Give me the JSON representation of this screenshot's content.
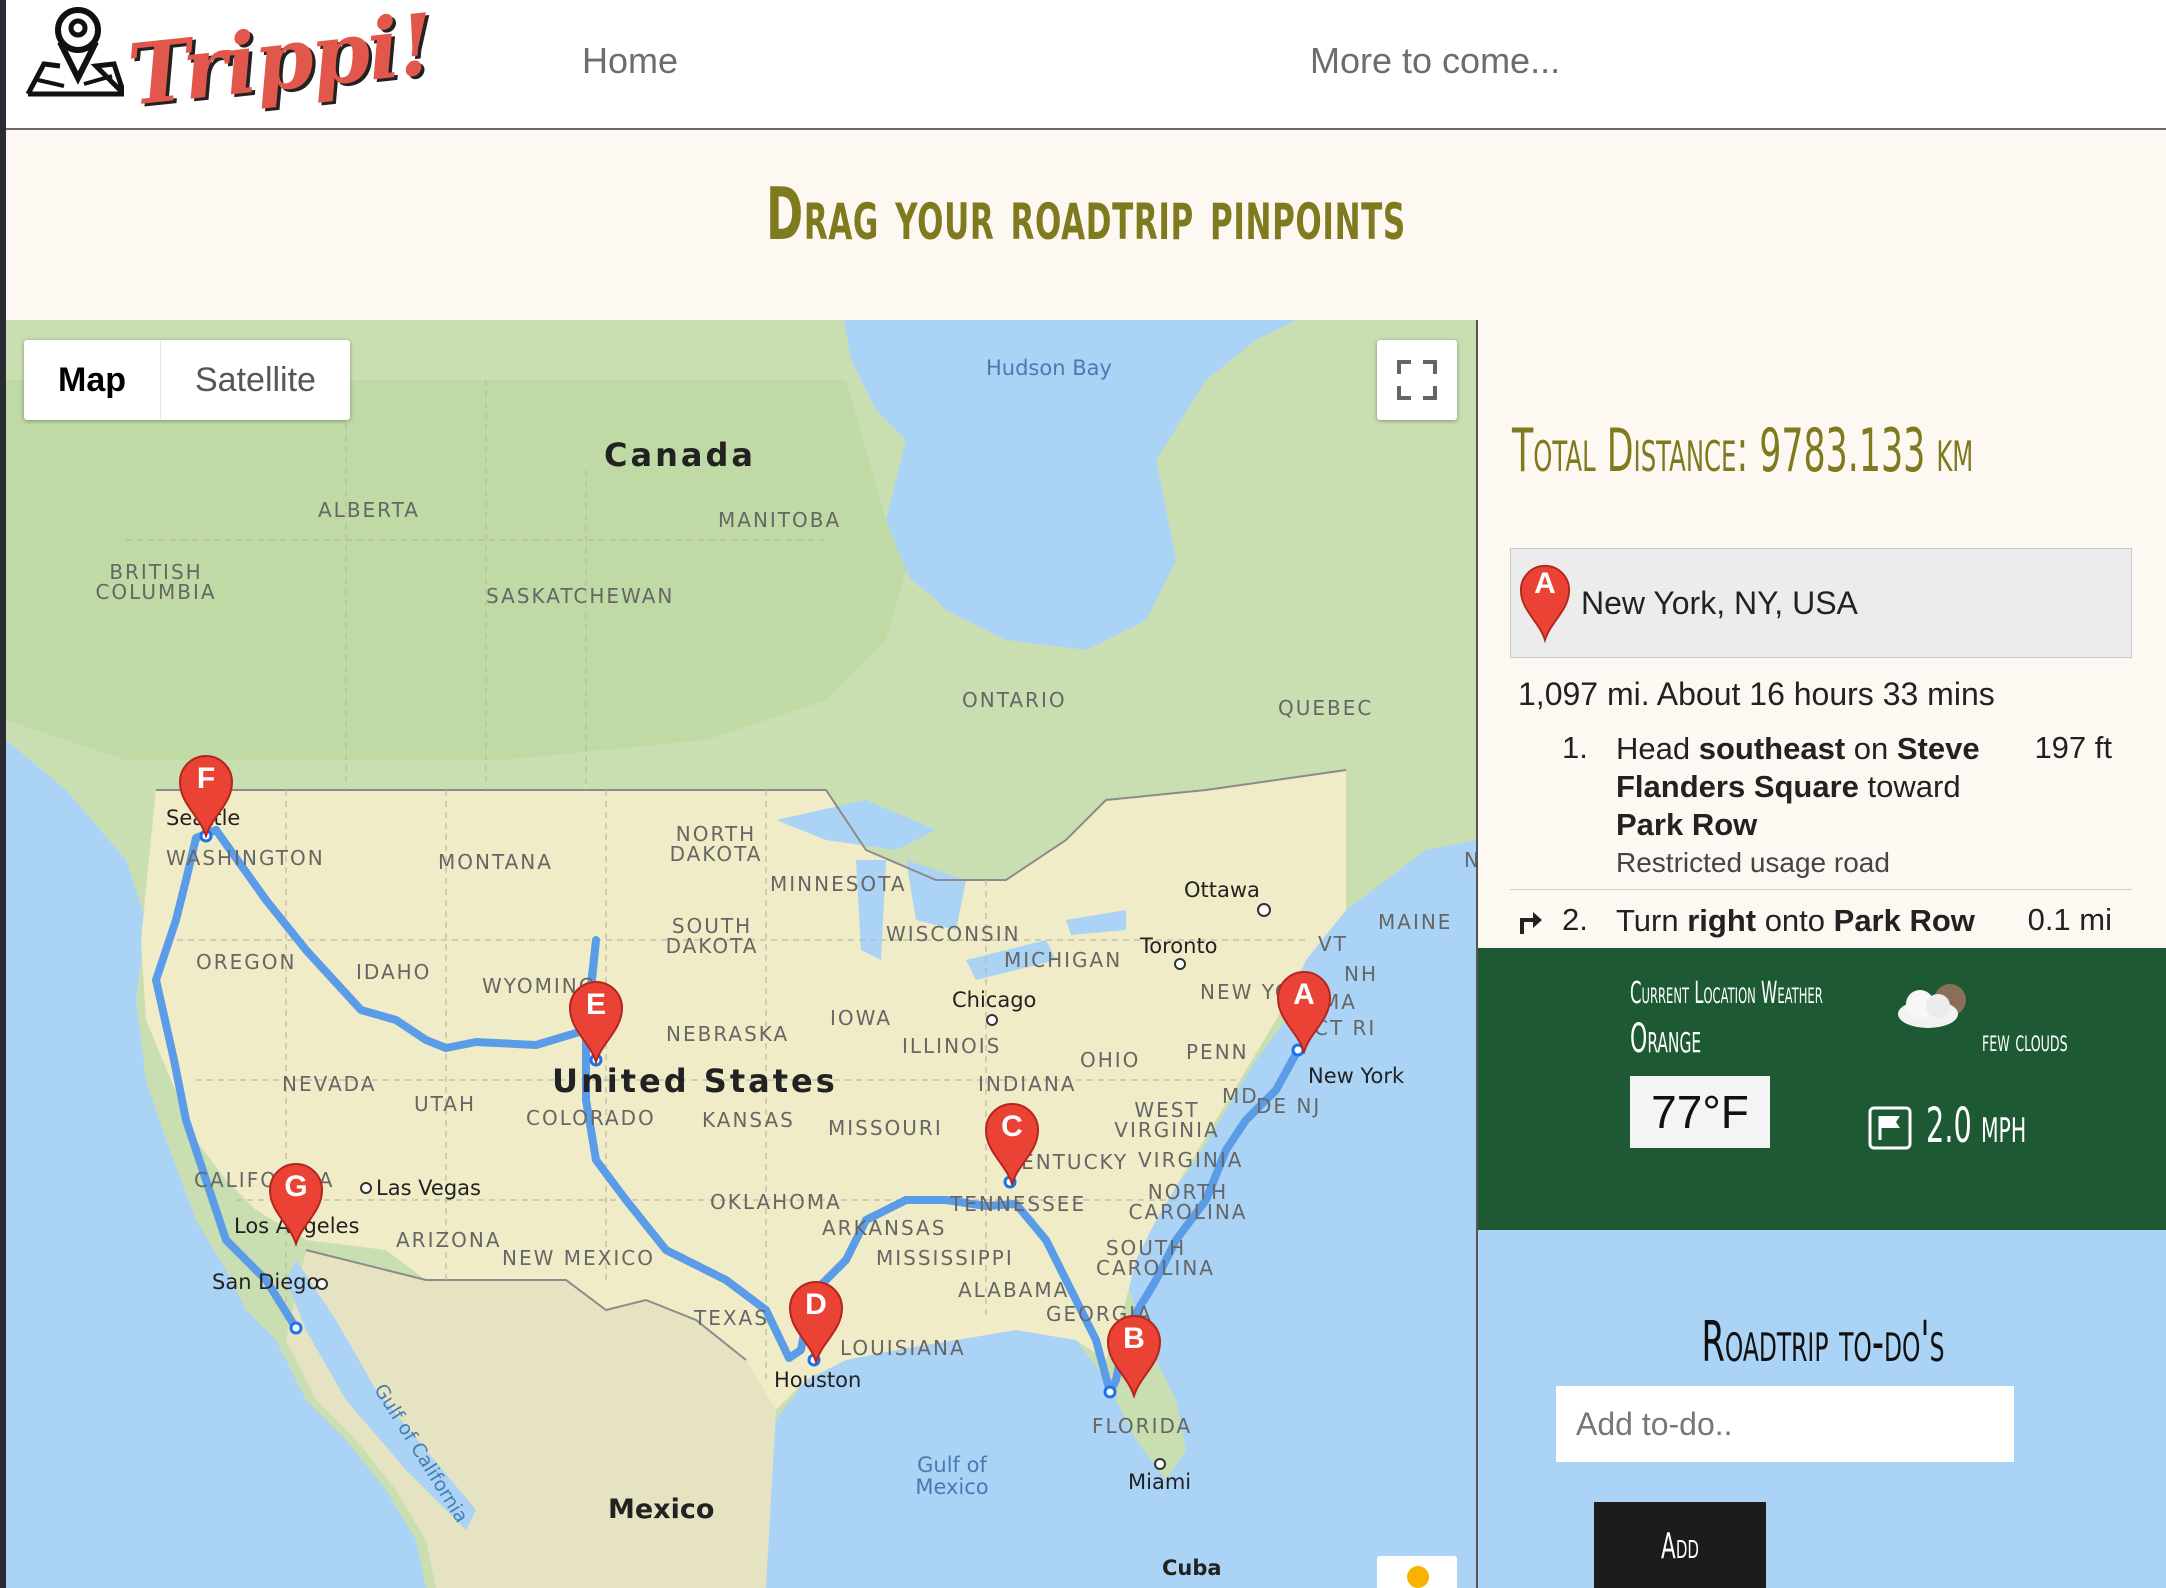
{
  "nav": {
    "brand": "Trippi!",
    "links": [
      "Home",
      "More to come..."
    ]
  },
  "hero": {
    "title": "Drag your roadtrip pinpoints"
  },
  "map": {
    "type_buttons": [
      "Map",
      "Satellite"
    ],
    "active_type": "Map",
    "labels": {
      "countries": [
        "Canada",
        "United States",
        "Mexico",
        "Cuba"
      ],
      "water": [
        "Hudson Bay",
        "Gulf of Mexico",
        "Gulf of California"
      ],
      "regions": [
        "ALBERTA",
        "BRITISH COLUMBIA",
        "MANITOBA",
        "SASKATCHEWAN",
        "ONTARIO",
        "QUEBEC",
        "WASHINGTON",
        "MONTANA",
        "NORTH DAKOTA",
        "MINNESOTA",
        "SOUTH DAKOTA",
        "WISCONSIN",
        "MICHIGAN",
        "OREGON",
        "IDAHO",
        "WYOMING",
        "NEBRASKA",
        "IOWA",
        "ILLINOIS",
        "INDIANA",
        "OHIO",
        "PENN",
        "NEVADA",
        "UTAH",
        "COLORADO",
        "KANSAS",
        "MISSOURI",
        "KENTUCKY",
        "WEST VIRGINIA",
        "VIRGINIA",
        "CALIFORNIA",
        "OKLAHOMA",
        "TENNESSEE",
        "NORTH CAROLINA",
        "ARIZONA",
        "NEW MEXICO",
        "ARKANSAS",
        "MISSISSIPPI",
        "SOUTH CAROLINA",
        "ALABAMA",
        "GEORGIA",
        "TEXAS",
        "LOUISIANA",
        "FLORIDA",
        "MAINE",
        "VT",
        "NH",
        "MA",
        "CT RI",
        "NEW YORK",
        "MD",
        "DE NJ",
        "N"
      ],
      "cities": [
        "Seattle",
        "Las Vegas",
        "Los Angeles",
        "San Diego",
        "Chicago",
        "Toronto",
        "Ottawa",
        "New York",
        "Houston",
        "Miami"
      ]
    },
    "markers": [
      "A",
      "B",
      "C",
      "D",
      "E",
      "F",
      "G"
    ],
    "route_color": "#5b9ce8",
    "marker_color": "#ea4335"
  },
  "directions": {
    "total_distance": "Total Distance: 9783.133 km",
    "start_marker": "A",
    "start_address": "New York, NY, USA",
    "summary": "1,097 mi. About 16 hours 33 mins",
    "steps": [
      {
        "num": "1.",
        "parts": [
          "Head ",
          "southeast",
          " on ",
          "Steve Flanders Square",
          " toward ",
          "Park Row"
        ],
        "note": "Restricted usage road",
        "distance": "197 ft"
      },
      {
        "num": "2.",
        "parts": [
          "Turn ",
          "right",
          " onto ",
          "Park Row"
        ],
        "distance": "0.1 mi",
        "icon": "turn-right-icon"
      }
    ]
  },
  "weather": {
    "title": "Current Location Weather",
    "city": "Orange",
    "temperature": "77°F",
    "description": "few clouds",
    "wind": "2.0 mph",
    "background": "#1d5a34"
  },
  "todo": {
    "title": "Roadtrip to-do's",
    "placeholder": "Add to-do..",
    "add_label": "Add"
  }
}
